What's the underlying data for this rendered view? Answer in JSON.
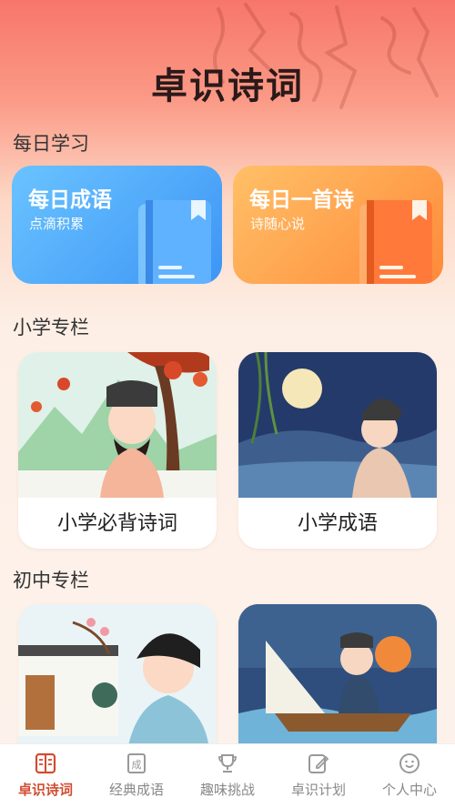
{
  "app_title": "卓识诗词",
  "sections": {
    "daily": "每日学习",
    "primary": "小学专栏",
    "middle": "初中专栏"
  },
  "daily_cards": [
    {
      "title": "每日成语",
      "subtitle": "点滴积累"
    },
    {
      "title": "每日一首诗",
      "subtitle": "诗随心说"
    }
  ],
  "primary_cards": [
    {
      "label": "小学必背诗词"
    },
    {
      "label": "小学成语"
    }
  ],
  "tabs": [
    {
      "label": "卓识诗词",
      "icon": "book-icon",
      "active": true
    },
    {
      "label": "经典成语",
      "icon": "idiom-card-icon",
      "active": false
    },
    {
      "label": "趣味挑战",
      "icon": "trophy-icon",
      "active": false
    },
    {
      "label": "卓识计划",
      "icon": "plan-edit-icon",
      "active": false
    },
    {
      "label": "个人中心",
      "icon": "smile-face-icon",
      "active": false
    }
  ],
  "colors": {
    "accent": "#d24c30",
    "blue_card": "#3d95f5",
    "orange_card": "#ff8a3a"
  }
}
